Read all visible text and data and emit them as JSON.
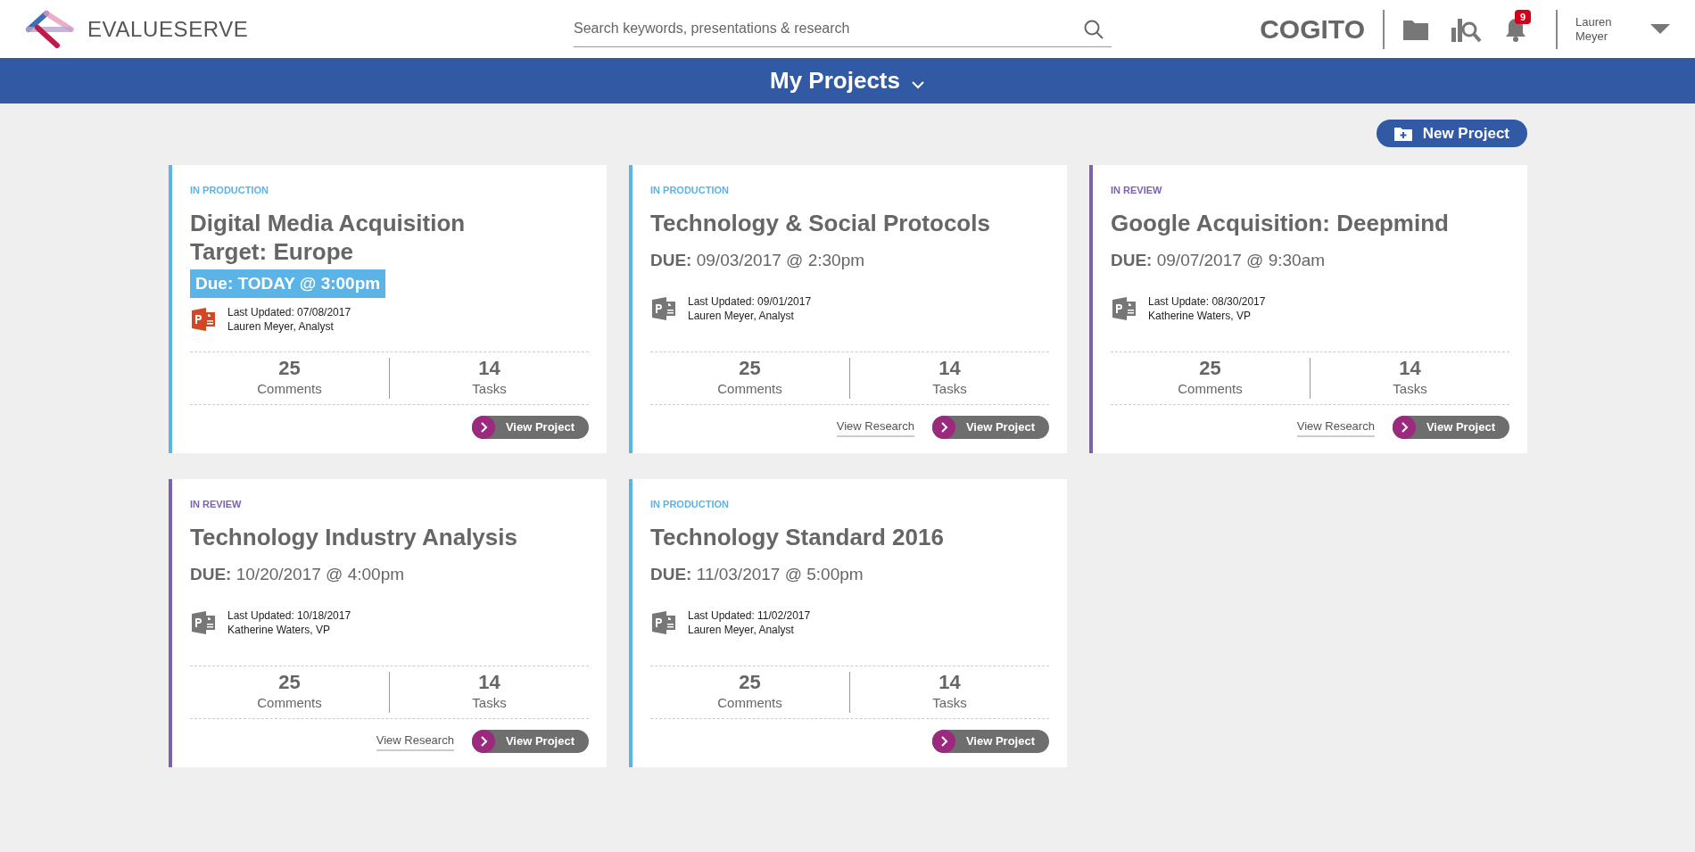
{
  "header": {
    "brand": "EVALUESERVE",
    "search": {
      "placeholder": "Search keywords, presentations & research"
    },
    "app_name": "COGITO",
    "notifications": "9",
    "user": "Lauren Meyer"
  },
  "title_bar": {
    "title": "My Projects"
  },
  "new_project": "New Project",
  "projects": [
    {
      "status": "IN PRODUCTION",
      "color": "#5bb4e5",
      "title_lines": [
        "Digital Media Acquisition",
        "Target: Europe"
      ],
      "due": {
        "kind": "urgent",
        "text": "Due: TODAY @ 3:00pm"
      },
      "file": {
        "color": "#d24726",
        "updated": "Last Updated: 07/08/2017",
        "author": "Lauren Meyer, Analyst"
      },
      "comments": "25",
      "comments_label": "Comments",
      "tasks": "14",
      "tasks_label": "Tasks",
      "button": "View Project"
    },
    {
      "status": "IN PRODUCTION",
      "color": "#5bb4e5",
      "title_lines": [
        "Technology & Social Protocols"
      ],
      "due": {
        "kind": "normal",
        "text": "**DUE:** 09/03/2017 @ 2:30pm"
      },
      "file": {
        "color": "#777777",
        "updated": "Last Updated: 09/01/2017",
        "author": "Lauren Meyer, Analyst"
      },
      "comments": "25",
      "comments_label": "Comments",
      "tasks": "14",
      "tasks_label": "Tasks",
      "links": [
        "View Research"
      ],
      "button": "View Project"
    },
    {
      "status": "IN REVIEW",
      "color": "#7b62ad",
      "title_lines": [
        "Google Acquisition: Deepmind"
      ],
      "due": {
        "kind": "normal",
        "text": "**DUE:** 09/07/2017 @ 9:30am"
      },
      "file": {
        "color": "#777777",
        "updated": "Last Update: 08/30/2017",
        "author": "Katherine Waters, VP"
      },
      "comments": "25",
      "comments_label": "Comments",
      "tasks": "14",
      "tasks_label": "Tasks",
      "links": [
        "View Research"
      ],
      "button": "View Project"
    },
    {
      "status": "IN REVIEW",
      "color": "#7b62ad",
      "title_lines": [
        "Technology Industry Analysis"
      ],
      "due": {
        "kind": "normal",
        "text": "**DUE:** 10/20/2017 @ 4:00pm"
      },
      "file": {
        "color": "#777777",
        "updated": "Last Updated: 10/18/2017",
        "author": "Katherine Waters, VP"
      },
      "comments": "25",
      "comments_label": "Comments",
      "tasks": "14",
      "tasks_label": "Tasks",
      "links": [
        "View Research"
      ],
      "button": "View Project"
    },
    {
      "status": "IN PRODUCTION",
      "color": "#5bb4e5",
      "title_lines": [
        "Technology Standard 2016"
      ],
      "due": {
        "kind": "normal",
        "text": "**DUE:** 11/03/2017 @ 5:00pm"
      },
      "file": {
        "color": "#777777",
        "updated": "Last Updated: 11/02/2017",
        "author": "Lauren Meyer, Analyst"
      },
      "comments": "25",
      "comments_label": "Comments",
      "tasks": "14",
      "tasks_label": "Tasks",
      "button": "View Project"
    }
  ]
}
